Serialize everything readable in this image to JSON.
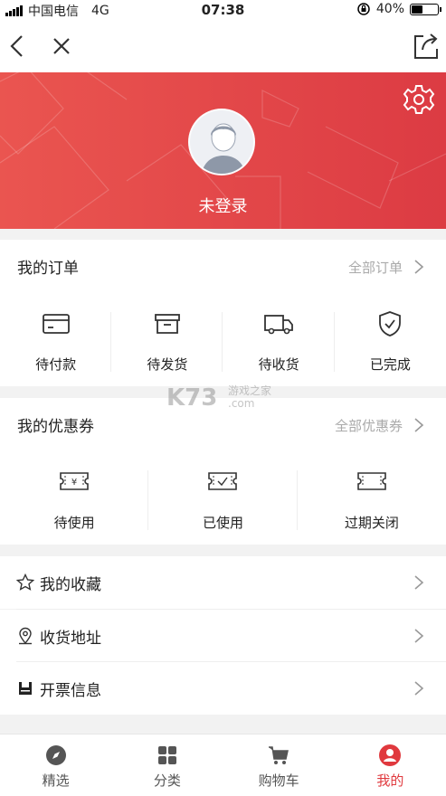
{
  "status": {
    "carrier": "中国电信",
    "network": "4G",
    "time": "07:38",
    "battery": "40%",
    "battery_level": 0.4
  },
  "user": {
    "login_label": "未登录"
  },
  "orders": {
    "title": "我的订单",
    "more": "全部订单",
    "items": [
      {
        "label": "待付款",
        "icon": "card-icon"
      },
      {
        "label": "待发货",
        "icon": "box-icon"
      },
      {
        "label": "待收货",
        "icon": "truck-icon"
      },
      {
        "label": "已完成",
        "icon": "shield-check-icon"
      }
    ]
  },
  "coupons": {
    "title": "我的优惠券",
    "more": "全部优惠券",
    "items": [
      {
        "label": "待使用",
        "icon": "yen-ticket-icon"
      },
      {
        "label": "已使用",
        "icon": "checked-ticket-icon"
      },
      {
        "label": "过期关闭",
        "icon": "blank-ticket-icon"
      }
    ]
  },
  "menu": [
    {
      "label": "我的收藏",
      "icon": "star-icon"
    },
    {
      "label": "收货地址",
      "icon": "location-icon"
    },
    {
      "label": "开票信息",
      "icon": "invoice-icon"
    }
  ],
  "watermark": {
    "brand": "K73",
    "site": "游戏之家",
    "domain": ".com"
  },
  "tabs": [
    {
      "label": "精选",
      "icon": "compass-icon",
      "active": false
    },
    {
      "label": "分类",
      "icon": "grid-icon",
      "active": false
    },
    {
      "label": "购物车",
      "icon": "cart-icon",
      "active": false
    },
    {
      "label": "我的",
      "icon": "profile-icon",
      "active": true
    }
  ],
  "colors": {
    "accent": "#e0393e",
    "hero_start": "#ea5550",
    "hero_end": "#dc3b43"
  }
}
